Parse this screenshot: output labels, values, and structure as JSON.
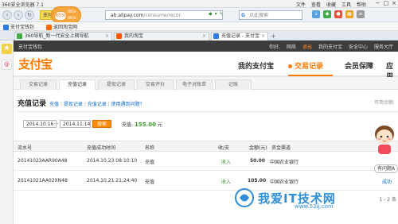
{
  "browser": {
    "title": "360安全浏览器 7.1",
    "menu": [
      "文件",
      "查看",
      "收藏",
      "工具",
      "帮助"
    ],
    "window_controls": [
      "−",
      "□",
      "×"
    ],
    "yellow_tag": "支付宝",
    "speed": {
      "pct": "65%",
      "up": "0K/s",
      "down": "0K/s"
    },
    "url": {
      "host": "ab.alipay.com",
      "path": "/consume/recor"
    },
    "search_placeholder": "点此搜索"
  },
  "favorites": {
    "items": [
      "支付宝钱包",
      "返回淘宝网"
    ]
  },
  "tabs": [
    {
      "label": "360导航_新一代安全上网导航"
    },
    {
      "label": "我的淘宝"
    },
    {
      "label": "充值记录 - 支付宝"
    }
  ],
  "site_header": {
    "left": "支付宝钱包",
    "right": [
      "你好,",
      "网商",
      "退出",
      "我的支付宝",
      "安全中心",
      "服务大厅"
    ]
  },
  "logo": {
    "text": "支付宝",
    "sub": ""
  },
  "main_nav": {
    "items": [
      "我的支付宝",
      "交易记录",
      "会员保障",
      "应用"
    ],
    "active_index": 1
  },
  "sub_tabs": {
    "items": [
      "交易记录",
      "充值记录",
      "提现记录",
      "交易评价",
      "电子对账单",
      "记账"
    ],
    "active_index": 1
  },
  "page": {
    "title": "充值记录",
    "quick_links": [
      "充值",
      "提现记录",
      "充值记录",
      "使用遇到问题?"
    ],
    "right_note": "可用余额:",
    "date_from": "2014.10.16",
    "date_sep": "-",
    "date_to": "2014.11.14",
    "query_label": "搜索",
    "total_label": "充值:",
    "total_amount": "155.00",
    "total_unit": "元"
  },
  "table": {
    "headers": [
      "流水号",
      "充值成功时间",
      "名称",
      "收/支",
      "金额(元)",
      "资金渠道"
    ],
    "rows": [
      {
        "serial": "20141023AAR90A48",
        "time": "2014.10.23 08:10:10",
        "name": "充值",
        "io": "收入",
        "amount": "50.00",
        "channel": "中国农业银行",
        "detail": ""
      },
      {
        "serial": "20141021AA02XN48",
        "time": "2014.10.21 21:24:40",
        "name": "充值",
        "io": "收入",
        "amount": "105.00",
        "channel": "中国农业银行",
        "detail": "成功"
      }
    ]
  },
  "mascot_bubble": "有问题A",
  "pager": "1 - 2 条",
  "watermark": {
    "text": "我爱IT技术网",
    "url": "www.52ij.com"
  },
  "colors": {
    "brand_orange": "#ff7a00",
    "income_green": "#3b9a2b",
    "link_blue": "#0a6bc4",
    "header_dark": "#3c3c3c"
  }
}
